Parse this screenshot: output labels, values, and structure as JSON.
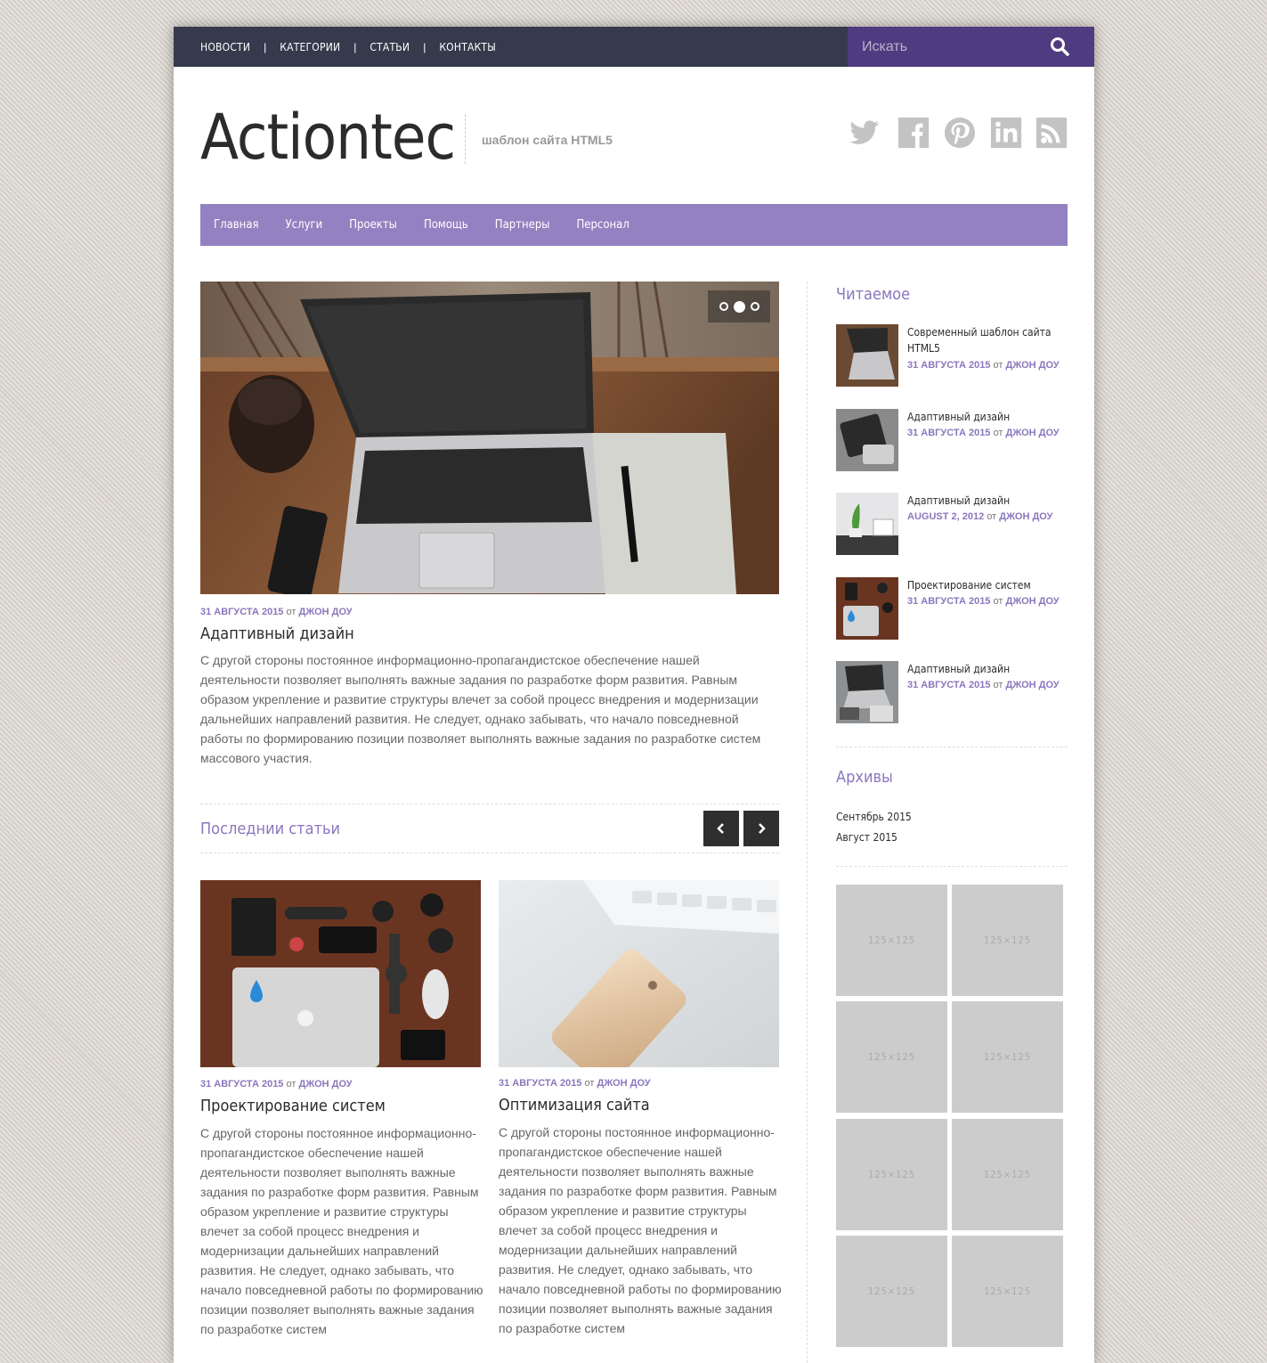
{
  "topnav": {
    "items": [
      "НОВОСТИ",
      "КАТЕГОРИИ",
      "СТАТЬИ",
      "КОНТАКТЫ"
    ],
    "sep": "|"
  },
  "search": {
    "placeholder": "Искать"
  },
  "header": {
    "logo": "Actiontec",
    "tagline": "шаблон сайта HTML5",
    "social_icons": [
      "twitter-icon",
      "facebook-icon",
      "pinterest-icon",
      "linkedin-icon",
      "rss-icon"
    ]
  },
  "menu": {
    "items": [
      "Главная",
      "Услуги",
      "Проекты",
      "Помощь",
      "Партнеры",
      "Персонал"
    ]
  },
  "slider": {
    "dots": 3,
    "active_dot": 2
  },
  "featured": {
    "date": "31 АВГУСТА 2015",
    "by": "от",
    "author": "ДЖОН ДОУ",
    "title": "Адаптивный дизайн",
    "text": "С другой стороны постоянное информационно-пропагандистское обеспечение нашей деятельности позволяет выполнять важные задания по разработке форм развития. Равным образом укрепление и развитие структуры влечет за собой процесс внедрения и модернизации дальнейших направлений развития. Не следует, однако забывать, что начало повседневной работы по формированию позиции позволяет выполнять важные задания по разработке систем массового участия."
  },
  "latest": {
    "title": "Последнии статьи",
    "posts": [
      {
        "date": "31 АВГУСТА 2015",
        "by": "от",
        "author": "ДЖОН ДОУ",
        "title": "Проектирование систем",
        "text": "С другой стороны постоянное информационно-пропагандистское обеспечение нашей деятельности позволяет выполнять важные задания по разработке форм развития. Равным образом укрепление и развитие структуры влечет за собой процесс внедрения и модернизации дальнейших направлений развития. Не следует, однако забывать, что начало повседневной работы по формированию позиции позволяет выполнять важные задания по разработке систем"
      },
      {
        "date": "31 АВГУСТА 2015",
        "by": "от",
        "author": "ДЖОН ДОУ",
        "title": "Оптимизация сайта",
        "text": "С другой стороны постоянное информационно-пропагандистское обеспечение нашей деятельности позволяет выполнять важные задания по разработке форм развития. Равным образом укрепление и развитие структуры влечет за собой процесс внедрения и модернизации дальнейших направлений развития. Не следует, однако забывать, что начало повседневной работы по формированию позиции позволяет выполнять важные задания по разработке систем"
      }
    ]
  },
  "sidebar": {
    "popular_title": "Читаемое",
    "popular": [
      {
        "title": "Современный шаблон сайта HTML5",
        "date": "31 АВГУСТА 2015",
        "by": "от",
        "author": "ДЖОН ДОУ"
      },
      {
        "title": "Адаптивный дизайн",
        "date": "31 АВГУСТА 2015",
        "by": "от",
        "author": "ДЖОН ДОУ"
      },
      {
        "title": "Адаптивный дизайн",
        "date": "AUGUST 2, 2012",
        "by": "от",
        "author": "ДЖОН ДОУ"
      },
      {
        "title": "Проектирование систем",
        "date": "31 АВГУСТА 2015",
        "by": "от",
        "author": "ДЖОН ДОУ"
      },
      {
        "title": "Адаптивный дизайн",
        "date": "31 АВГУСТА 2015",
        "by": "от",
        "author": "ДЖОН ДОУ"
      }
    ],
    "archives_title": "Архивы",
    "archives": [
      "Сентябрь 2015",
      "Август 2015"
    ],
    "ad_label": "125×125"
  }
}
